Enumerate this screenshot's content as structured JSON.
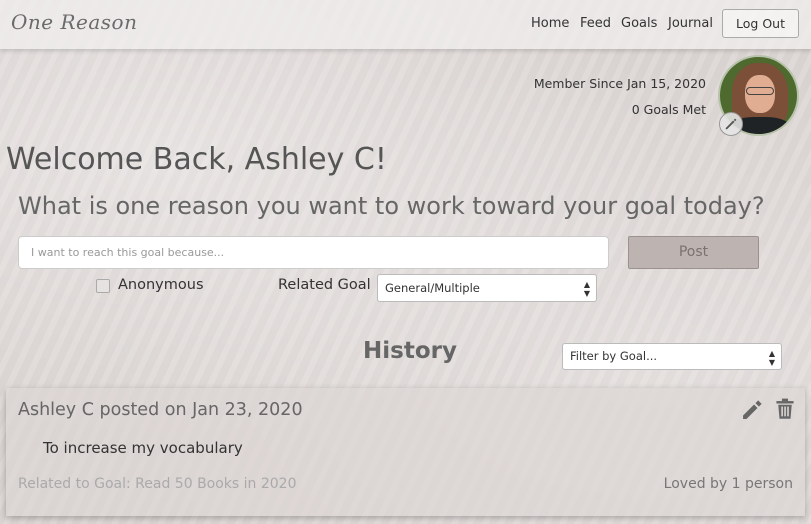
{
  "nav": {
    "brand": "One Reason",
    "links": [
      "Home",
      "Feed",
      "Goals",
      "Journal"
    ],
    "logout": "Log Out"
  },
  "profile": {
    "member_since": "Member Since Jan 15, 2020",
    "goals_met": "0 Goals Met"
  },
  "welcome": "Welcome Back, Ashley C!",
  "prompt": {
    "question": "What is one reason you want to work toward your goal today?",
    "placeholder": "I want to reach this goal because...",
    "value": "",
    "post_label": "Post",
    "anonymous_label": "Anonymous",
    "anonymous_checked": false,
    "related_goal_label": "Related Goal",
    "related_goal_selected": "General/Multiple"
  },
  "history": {
    "title": "History",
    "filter_selected": "Filter by Goal..."
  },
  "posts": [
    {
      "header": "Ashley C posted on Jan 23, 2020",
      "reason": "To increase my vocabulary",
      "related": "Related to Goal: Read 50 Books in 2020",
      "loved": "Loved by 1 person"
    }
  ],
  "icons": {
    "edit": "pencil-icon",
    "delete": "trash-icon",
    "avatar_edit": "pencil-icon"
  }
}
